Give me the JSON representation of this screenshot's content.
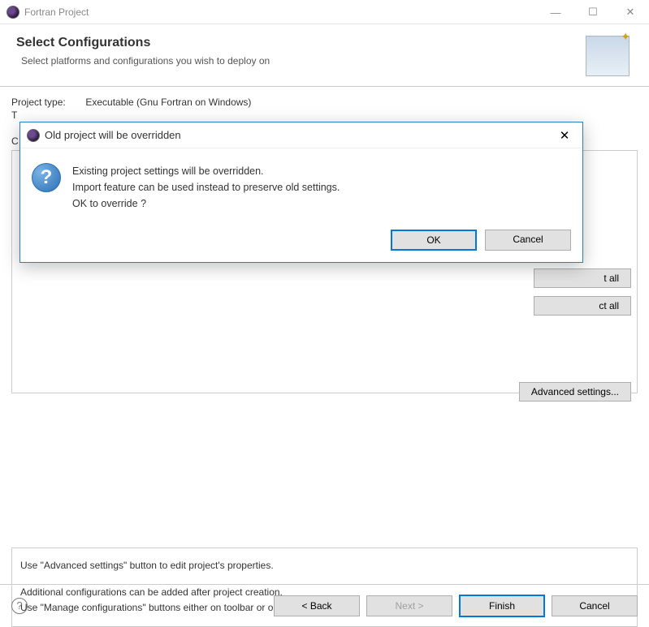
{
  "window": {
    "title": "Fortran Project",
    "controls": {
      "min": "—",
      "max": "☐",
      "close": "✕"
    }
  },
  "page": {
    "title": "Select Configurations",
    "subtitle": "Select platforms and configurations you wish to deploy on"
  },
  "fields": {
    "project_type_label": "Project type:",
    "project_type_value": "Executable (Gnu Fortran on Windows)",
    "toolchains_label": "T",
    "configs_label": "C"
  },
  "buttons": {
    "select_all_suffix": "t all",
    "deselect_all_suffix": "ct all",
    "advanced": "Advanced settings..."
  },
  "help": {
    "line1": "Use \"Advanced settings\" button to edit project's properties.",
    "line2": "Additional configurations can be added after project creation.",
    "line3": "Use \"Manage configurations\" buttons either on toolbar or on property pages."
  },
  "wizard": {
    "back": "< Back",
    "next": "Next >",
    "finish": "Finish",
    "cancel": "Cancel"
  },
  "modal": {
    "title": "Old project will be overridden",
    "line1": "Existing project settings will be overridden.",
    "line2": "Import feature can be used instead to preserve old settings.",
    "line3": "OK to override ?",
    "ok": "OK",
    "cancel": "Cancel",
    "close": "✕"
  }
}
